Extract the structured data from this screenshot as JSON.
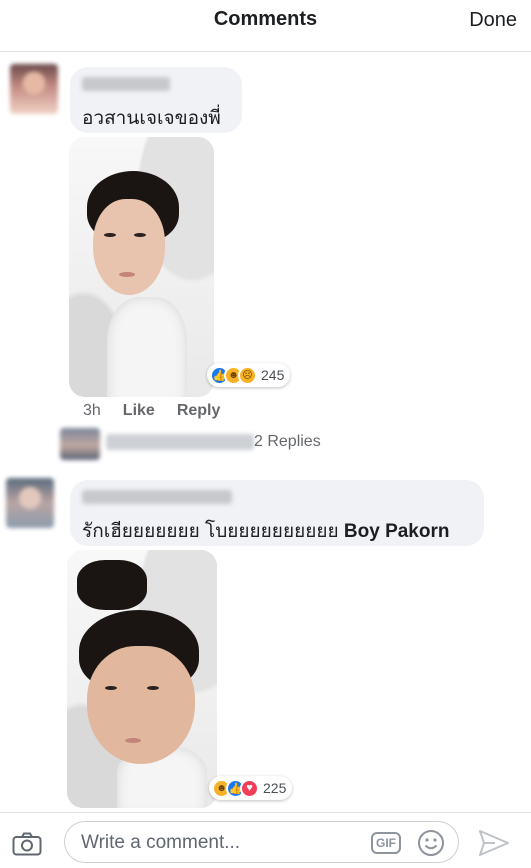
{
  "header": {
    "title": "Comments",
    "done_label": "Done"
  },
  "comments": [
    {
      "text": "อวสานเจเจของพี่",
      "reactions": {
        "icons": [
          "like-icon",
          "haha-icon",
          "sad-icon"
        ],
        "count": "245"
      },
      "time": "3h",
      "like_label": "Like",
      "reply_label": "Reply",
      "replies_label": "2 Replies"
    },
    {
      "text_prefix": "รักเฮียยยยยยย โบยยยยยยยยยย ",
      "text_name": "Boy Pakorn",
      "reactions": {
        "icons": [
          "haha-icon",
          "like-icon",
          "love-icon"
        ],
        "count": "225"
      }
    }
  ],
  "composer": {
    "placeholder": "Write a comment...",
    "gif_label": "GIF"
  },
  "colors": {
    "bubble": "#f0f2f5",
    "like": "#1877f2",
    "love": "#f33e58",
    "haha": "#f7b125",
    "secondary_text": "#65676b"
  }
}
